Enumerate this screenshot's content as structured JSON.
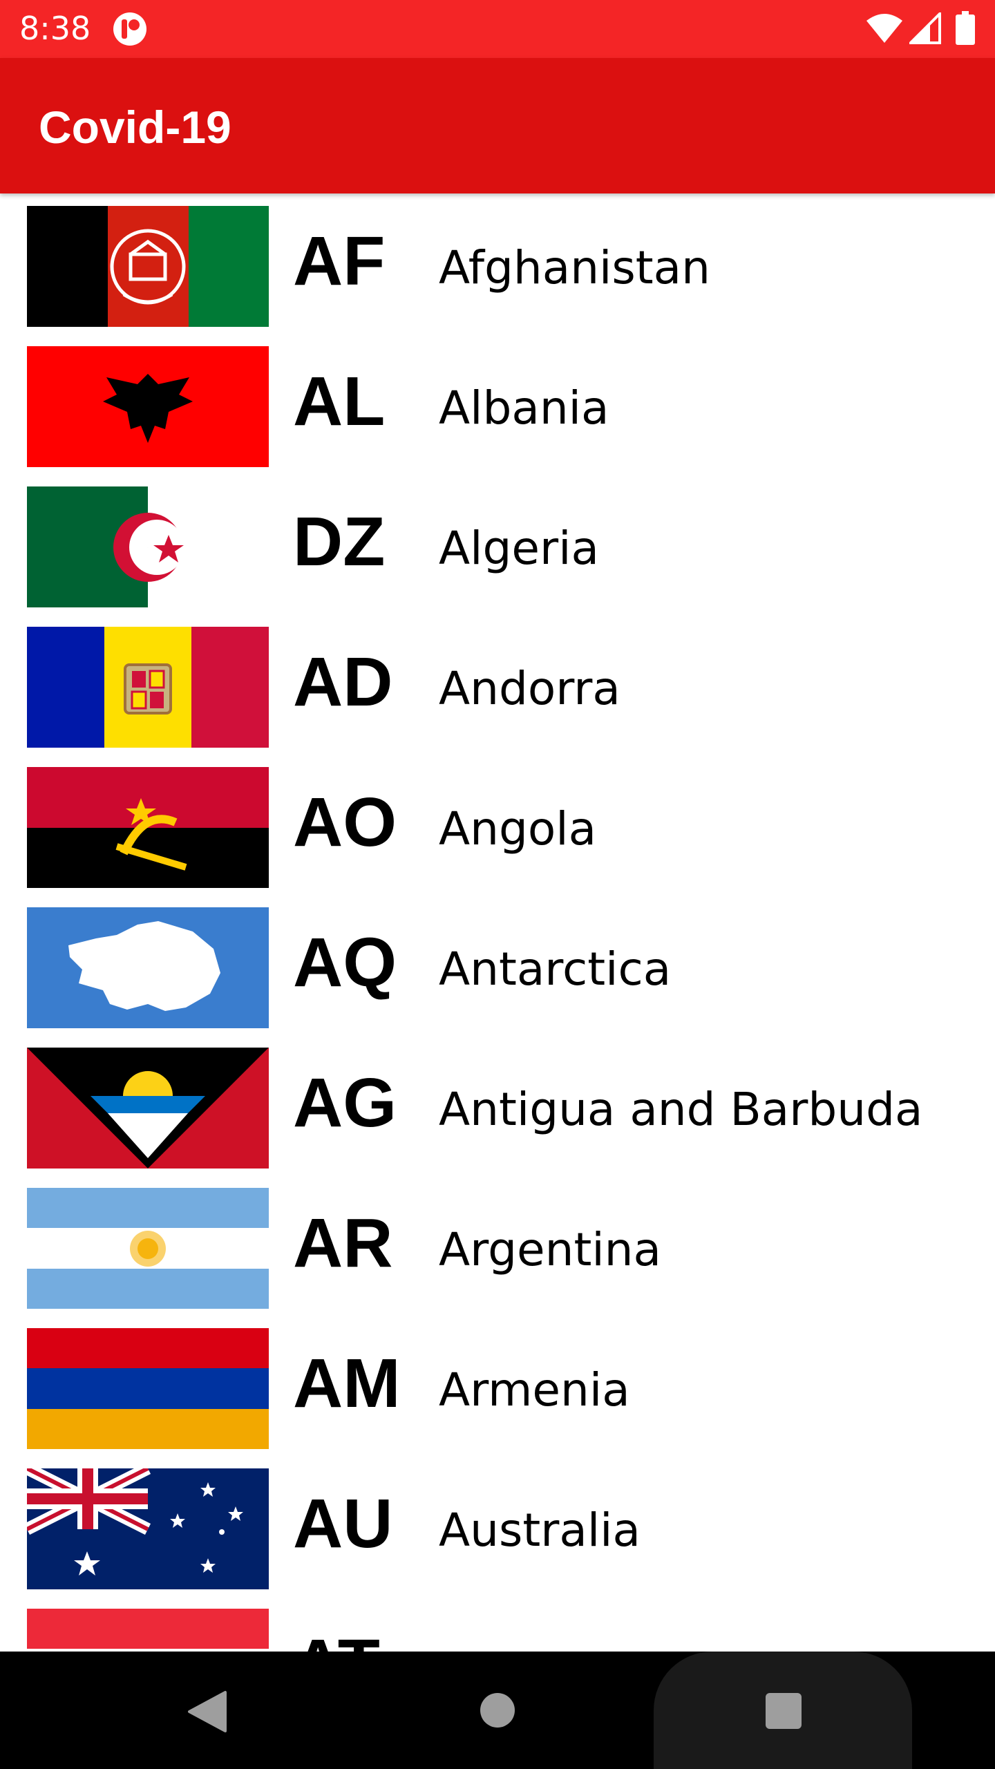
{
  "status_bar": {
    "time": "8:38",
    "app_icon": "app-notification-icon",
    "icons": [
      "wifi-icon",
      "signal-icon",
      "battery-icon"
    ],
    "color": "#F42526"
  },
  "app_bar": {
    "title": "Covid-19",
    "color": "#DB1010"
  },
  "countries": [
    {
      "code": "AF",
      "name": "Afghanistan",
      "flag": "afghanistan-flag-icon"
    },
    {
      "code": "AL",
      "name": "Albania",
      "flag": "albania-flag-icon"
    },
    {
      "code": "DZ",
      "name": "Algeria",
      "flag": "algeria-flag-icon"
    },
    {
      "code": "AD",
      "name": "Andorra",
      "flag": "andorra-flag-icon"
    },
    {
      "code": "AO",
      "name": "Angola",
      "flag": "angola-flag-icon"
    },
    {
      "code": "AQ",
      "name": "Antarctica",
      "flag": "antarctica-flag-icon"
    },
    {
      "code": "AG",
      "name": "Antigua and Barbuda",
      "flag": "antigua-flag-icon"
    },
    {
      "code": "AR",
      "name": "Argentina",
      "flag": "argentina-flag-icon"
    },
    {
      "code": "AM",
      "name": "Armenia",
      "flag": "armenia-flag-icon"
    },
    {
      "code": "AU",
      "name": "Australia",
      "flag": "australia-flag-icon"
    },
    {
      "code": "AT",
      "name": "",
      "flag": "austria-flag-icon"
    }
  ],
  "nav_bar": {
    "buttons": [
      "back-icon",
      "home-icon",
      "recents-icon"
    ]
  }
}
